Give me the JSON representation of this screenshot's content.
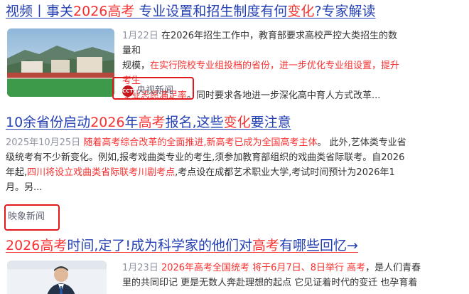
{
  "results": [
    {
      "title_parts": [
        {
          "text": "视频丨事关",
          "hl": false
        },
        {
          "text": "2026高考",
          "hl": true
        },
        {
          "text": " 专业设置和招生制度有何",
          "hl": false
        },
        {
          "text": "变化",
          "hl": true
        },
        {
          "text": "?专家解读",
          "hl": false
        }
      ],
      "date": "1月22日",
      "snippet_lines": [
        [
          {
            "text": "在2026年招生工作中，教育部要求高校严控大类招生的数量和",
            "red": false
          }
        ],
        [
          {
            "text": "规模，",
            "red": false
          },
          {
            "text": "在实行院校专业组投档的省份，进一步优化专业组设置，提升考生",
            "red": true
          }
        ],
        [
          {
            "text": "专业志愿满足率",
            "red": true
          },
          {
            "text": "。同时要求各地进一步深化高中育人方式改革...",
            "red": false
          }
        ]
      ],
      "source": "央视新闻",
      "source_logo": "CCTV"
    },
    {
      "title_parts": [
        {
          "text": "10余省份启动",
          "hl": false
        },
        {
          "text": "2026",
          "hl": true
        },
        {
          "text": "年",
          "hl": false
        },
        {
          "text": "高考",
          "hl": true
        },
        {
          "text": "报名,这些",
          "hl": false
        },
        {
          "text": "变化",
          "hl": true
        },
        {
          "text": "要注意",
          "hl": false
        }
      ],
      "date": "2025年10月25日",
      "snippet_lines": [
        [
          {
            "text": "随着高考综合改革的全面推进,新高考已成为全国高考主体",
            "red": true
          },
          {
            "text": "。 此外,艺体类专业省",
            "red": false
          }
        ],
        [
          {
            "text": "级统考有不少新变化。例如,报考戏曲类专业的考生,须参加教育部组织的戏曲类省际联考。自2026",
            "red": false
          }
        ],
        [
          {
            "text": "年起,",
            "red": false
          },
          {
            "text": "四川将设立戏曲类省际联考川剧考点",
            "red": true
          },
          {
            "text": ",考点设在成都艺术职业大学,考试时间预计为2026年1",
            "red": false
          }
        ],
        [
          {
            "text": "月。另...",
            "red": false
          }
        ]
      ],
      "source": "映象新闻"
    },
    {
      "title_parts": [
        {
          "text": "2026高考",
          "hl": true
        },
        {
          "text": "时间,定了!成为科学家的他们对",
          "hl": false
        },
        {
          "text": "高考",
          "hl": true
        },
        {
          "text": "有哪些回忆→",
          "hl": false
        }
      ],
      "date": "1月23日",
      "snippet_lines": [
        [
          {
            "text": "2026年高考全国统考 将于6月7日、8日举行 高考",
            "red": true
          },
          {
            "text": "，是人们青春",
            "red": false
          }
        ],
        [
          {
            "text": "里的共同印记 更是无数人奔赴理想的起点 它见证着时代的变迁 也孕育着",
            "red": false
          }
        ]
      ]
    }
  ]
}
